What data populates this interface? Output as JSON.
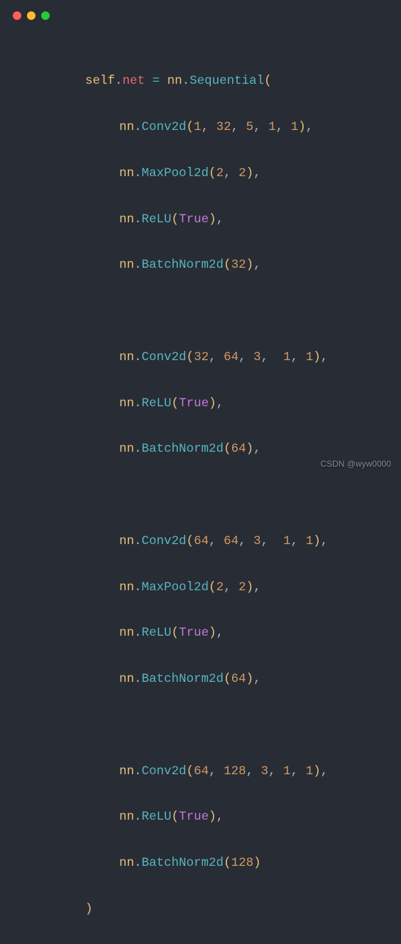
{
  "windowControls": {
    "red": "close",
    "yellow": "minimize",
    "green": "maximize"
  },
  "code": {
    "line1": {
      "self": "self",
      "dot1": ".",
      "attr": "net",
      "eq": " = ",
      "mod": "nn",
      "dot2": ".",
      "fn": "Sequential",
      "open": "("
    },
    "conv1": {
      "mod": "nn",
      "fn": "Conv2d",
      "a1": "1",
      "a2": "32",
      "a3": "5",
      "a4": "1",
      "a5": "1"
    },
    "pool1": {
      "mod": "nn",
      "fn": "MaxPool2d",
      "a1": "2",
      "a2": "2"
    },
    "relu1": {
      "mod": "nn",
      "fn": "ReLU",
      "a1": "True"
    },
    "bn1": {
      "mod": "nn",
      "fn": "BatchNorm2d",
      "a1": "32"
    },
    "conv2": {
      "mod": "nn",
      "fn": "Conv2d",
      "a1": "32",
      "a2": "64",
      "a3": "3",
      "a4": "1",
      "a5": "1"
    },
    "relu2": {
      "mod": "nn",
      "fn": "ReLU",
      "a1": "True"
    },
    "bn2": {
      "mod": "nn",
      "fn": "BatchNorm2d",
      "a1": "64"
    },
    "conv3": {
      "mod": "nn",
      "fn": "Conv2d",
      "a1": "64",
      "a2": "64",
      "a3": "3",
      "a4": "1",
      "a5": "1"
    },
    "pool3": {
      "mod": "nn",
      "fn": "MaxPool2d",
      "a1": "2",
      "a2": "2"
    },
    "relu3": {
      "mod": "nn",
      "fn": "ReLU",
      "a1": "True"
    },
    "bn3": {
      "mod": "nn",
      "fn": "BatchNorm2d",
      "a1": "64"
    },
    "conv4": {
      "mod": "nn",
      "fn": "Conv2d",
      "a1": "64",
      "a2": "128",
      "a3": "3",
      "a4": "1",
      "a5": "1"
    },
    "relu4": {
      "mod": "nn",
      "fn": "ReLU",
      "a1": "True"
    },
    "bn4": {
      "mod": "nn",
      "fn": "BatchNorm2d",
      "a1": "128"
    },
    "close": ")"
  },
  "watermark": "CSDN @wyw0000"
}
